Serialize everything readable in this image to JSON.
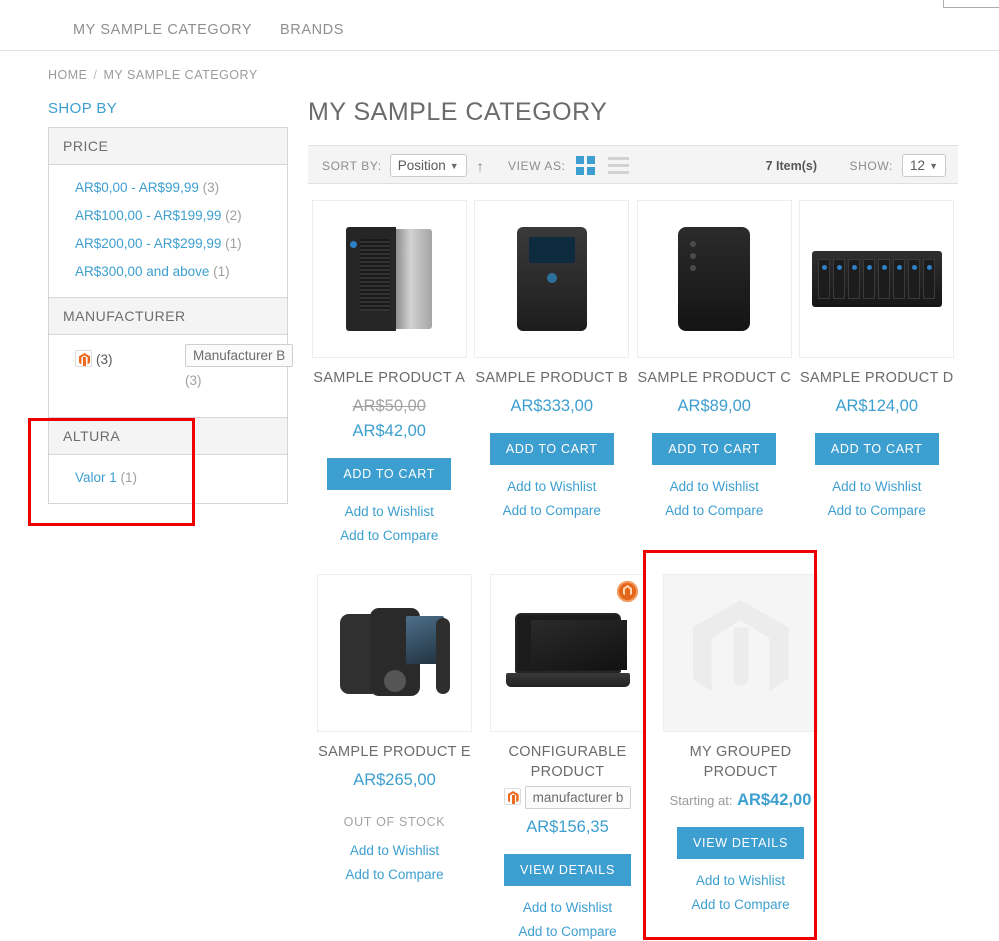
{
  "nav": {
    "items": [
      {
        "label": "MY SAMPLE CATEGORY"
      },
      {
        "label": "BRANDS"
      }
    ]
  },
  "breadcrumb": {
    "home": "HOME",
    "separator": "/",
    "current": "MY SAMPLE CATEGORY"
  },
  "sidebar": {
    "shop_by": "SHOP BY",
    "blocks": [
      {
        "title": "PRICE",
        "options": [
          {
            "label": "AR$0,00 - AR$99,99",
            "count": "(3)"
          },
          {
            "label": "AR$100,00 - AR$199,99",
            "count": "(2)"
          },
          {
            "label": "AR$200,00 - AR$299,99",
            "count": "(1)"
          },
          {
            "label": "AR$300,00 and above",
            "count": "(1)"
          }
        ]
      },
      {
        "title": "MANUFACTURER",
        "manufacturer_a_count": "(3)",
        "manufacturer_b_label": "Manufacturer B",
        "manufacturer_b_count": "(3)"
      },
      {
        "title": "ALTURA",
        "options": [
          {
            "label": "Valor 1",
            "count": "(1)"
          }
        ]
      }
    ]
  },
  "main": {
    "page_title": "MY SAMPLE CATEGORY",
    "toolbar": {
      "sort_by_label": "SORT BY:",
      "sort_by_value": "Position",
      "sort_direction": "↑",
      "view_as_label": "VIEW AS:",
      "item_count": "7 Item(s)",
      "show_label": "SHOW:",
      "show_value": "12"
    },
    "labels": {
      "add_to_cart": "ADD TO CART",
      "view_details": "VIEW DETAILS",
      "add_to_wishlist": "Add to Wishlist",
      "add_to_compare": "Add to Compare",
      "out_of_stock": "OUT OF STOCK",
      "starting_at": "Starting at:"
    },
    "products": [
      {
        "name": "SAMPLE PRODUCT A",
        "old_price": "AR$50,00",
        "price": "AR$42,00",
        "action": "ADD TO CART",
        "art": "nas"
      },
      {
        "name": "SAMPLE PRODUCT B",
        "price": "AR$333,00",
        "action": "ADD TO CART",
        "art": "tower"
      },
      {
        "name": "SAMPLE PRODUCT C",
        "price": "AR$89,00",
        "action": "ADD TO CART",
        "art": "tower2"
      },
      {
        "name": "SAMPLE PRODUCT D",
        "price": "AR$124,00",
        "action": "ADD TO CART",
        "art": "rack"
      },
      {
        "name": "SAMPLE PRODUCT E",
        "price": "AR$265,00",
        "stock": "OUT OF STOCK",
        "art": "phone"
      },
      {
        "name": "CONFIGURABLE PRODUCT",
        "manufacturer": "manufacturer b",
        "price": "AR$156,35",
        "action": "VIEW DETAILS",
        "art": "laptop",
        "badge": "magento-badge-icon"
      },
      {
        "name": "MY GROUPED PRODUCT",
        "starting_at": "Starting at:",
        "price": "AR$42,00",
        "action": "VIEW DETAILS",
        "art": "placeholder"
      }
    ]
  },
  "colors": {
    "accent": "#3d9fd0",
    "highlight": "#ee0000",
    "magento_orange": "#ef6a1e",
    "text": "#6b6b6b",
    "muted": "#a0a0a0"
  }
}
